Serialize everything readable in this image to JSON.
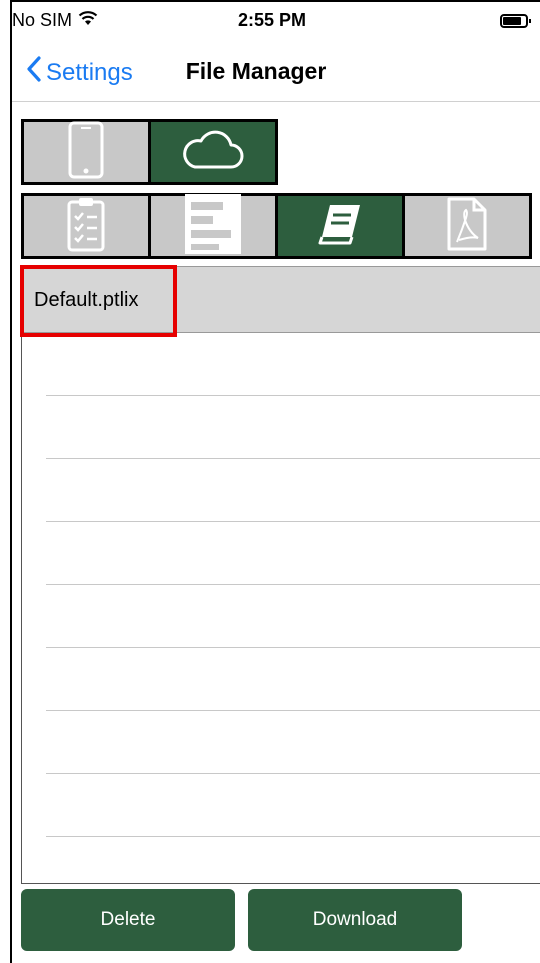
{
  "status_bar": {
    "carrier": "No SIM",
    "time": "2:55 PM"
  },
  "nav": {
    "back_label": "Settings",
    "title": "File Manager"
  },
  "location_tabs": [
    {
      "name": "device",
      "icon": "phone-icon",
      "selected": false
    },
    {
      "name": "cloud",
      "icon": "cloud-icon",
      "selected": true
    }
  ],
  "type_tabs": [
    {
      "name": "checklist",
      "icon": "clipboard-checklist-icon",
      "selected": false
    },
    {
      "name": "report",
      "icon": "bar-chart-icon",
      "selected": false
    },
    {
      "name": "library",
      "icon": "book-icon",
      "selected": true
    },
    {
      "name": "pdf",
      "icon": "pdf-icon",
      "selected": false
    }
  ],
  "files": [
    {
      "name": "Default.ptlix"
    }
  ],
  "buttons": {
    "delete": "Delete",
    "download": "Download"
  },
  "colors": {
    "accent_green": "#2d5e3e",
    "inactive_gray": "#c8c8c8",
    "link_blue": "#1a7bf2",
    "highlight_red": "#e60000"
  }
}
